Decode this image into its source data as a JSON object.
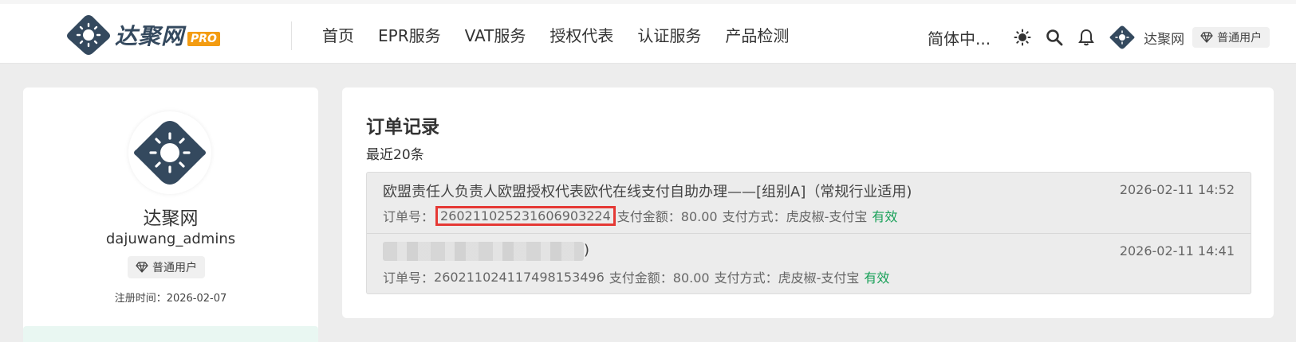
{
  "header": {
    "logo_text": "达聚网",
    "logo_badge": "PRO",
    "nav": [
      "首页",
      "EPR服务",
      "VAT服务",
      "授权代表",
      "认证服务",
      "产品检测"
    ],
    "language": "简体中...",
    "username": "达聚网",
    "role": "普通用户"
  },
  "profile": {
    "name": "达聚网",
    "account": "dajuwang_admins",
    "role": "普通用户",
    "register_time": "注册时间：2026-02-07"
  },
  "orders": {
    "title": "订单记录",
    "subtitle": "最近20条",
    "items": [
      {
        "title": "欧盟责任人负责人欧盟授权代表欧代在线支付自助办理——[组别A]（常规行业适用)",
        "date": "2026-02-11 14:52",
        "order_label": "订单号：",
        "order_no": "26021102523160690​3224",
        "amount_text": "支付金额：80.00",
        "method_text": "支付方式：虎皮椒-支付宝",
        "status": "有效"
      },
      {
        "title_tail": ")",
        "date": "2026-02-11 14:41",
        "order_label": "订单号：",
        "order_no": "26021102411749815349​6",
        "amount_text": "支付金额：80.00",
        "method_text": "支付方式：虎皮椒-支付宝",
        "status": "有效"
      }
    ]
  },
  "colors": {
    "brand_dark": "#34495e",
    "badge_orange": "#f39c12",
    "status_green": "#18a058",
    "highlight_red": "#e53935"
  }
}
